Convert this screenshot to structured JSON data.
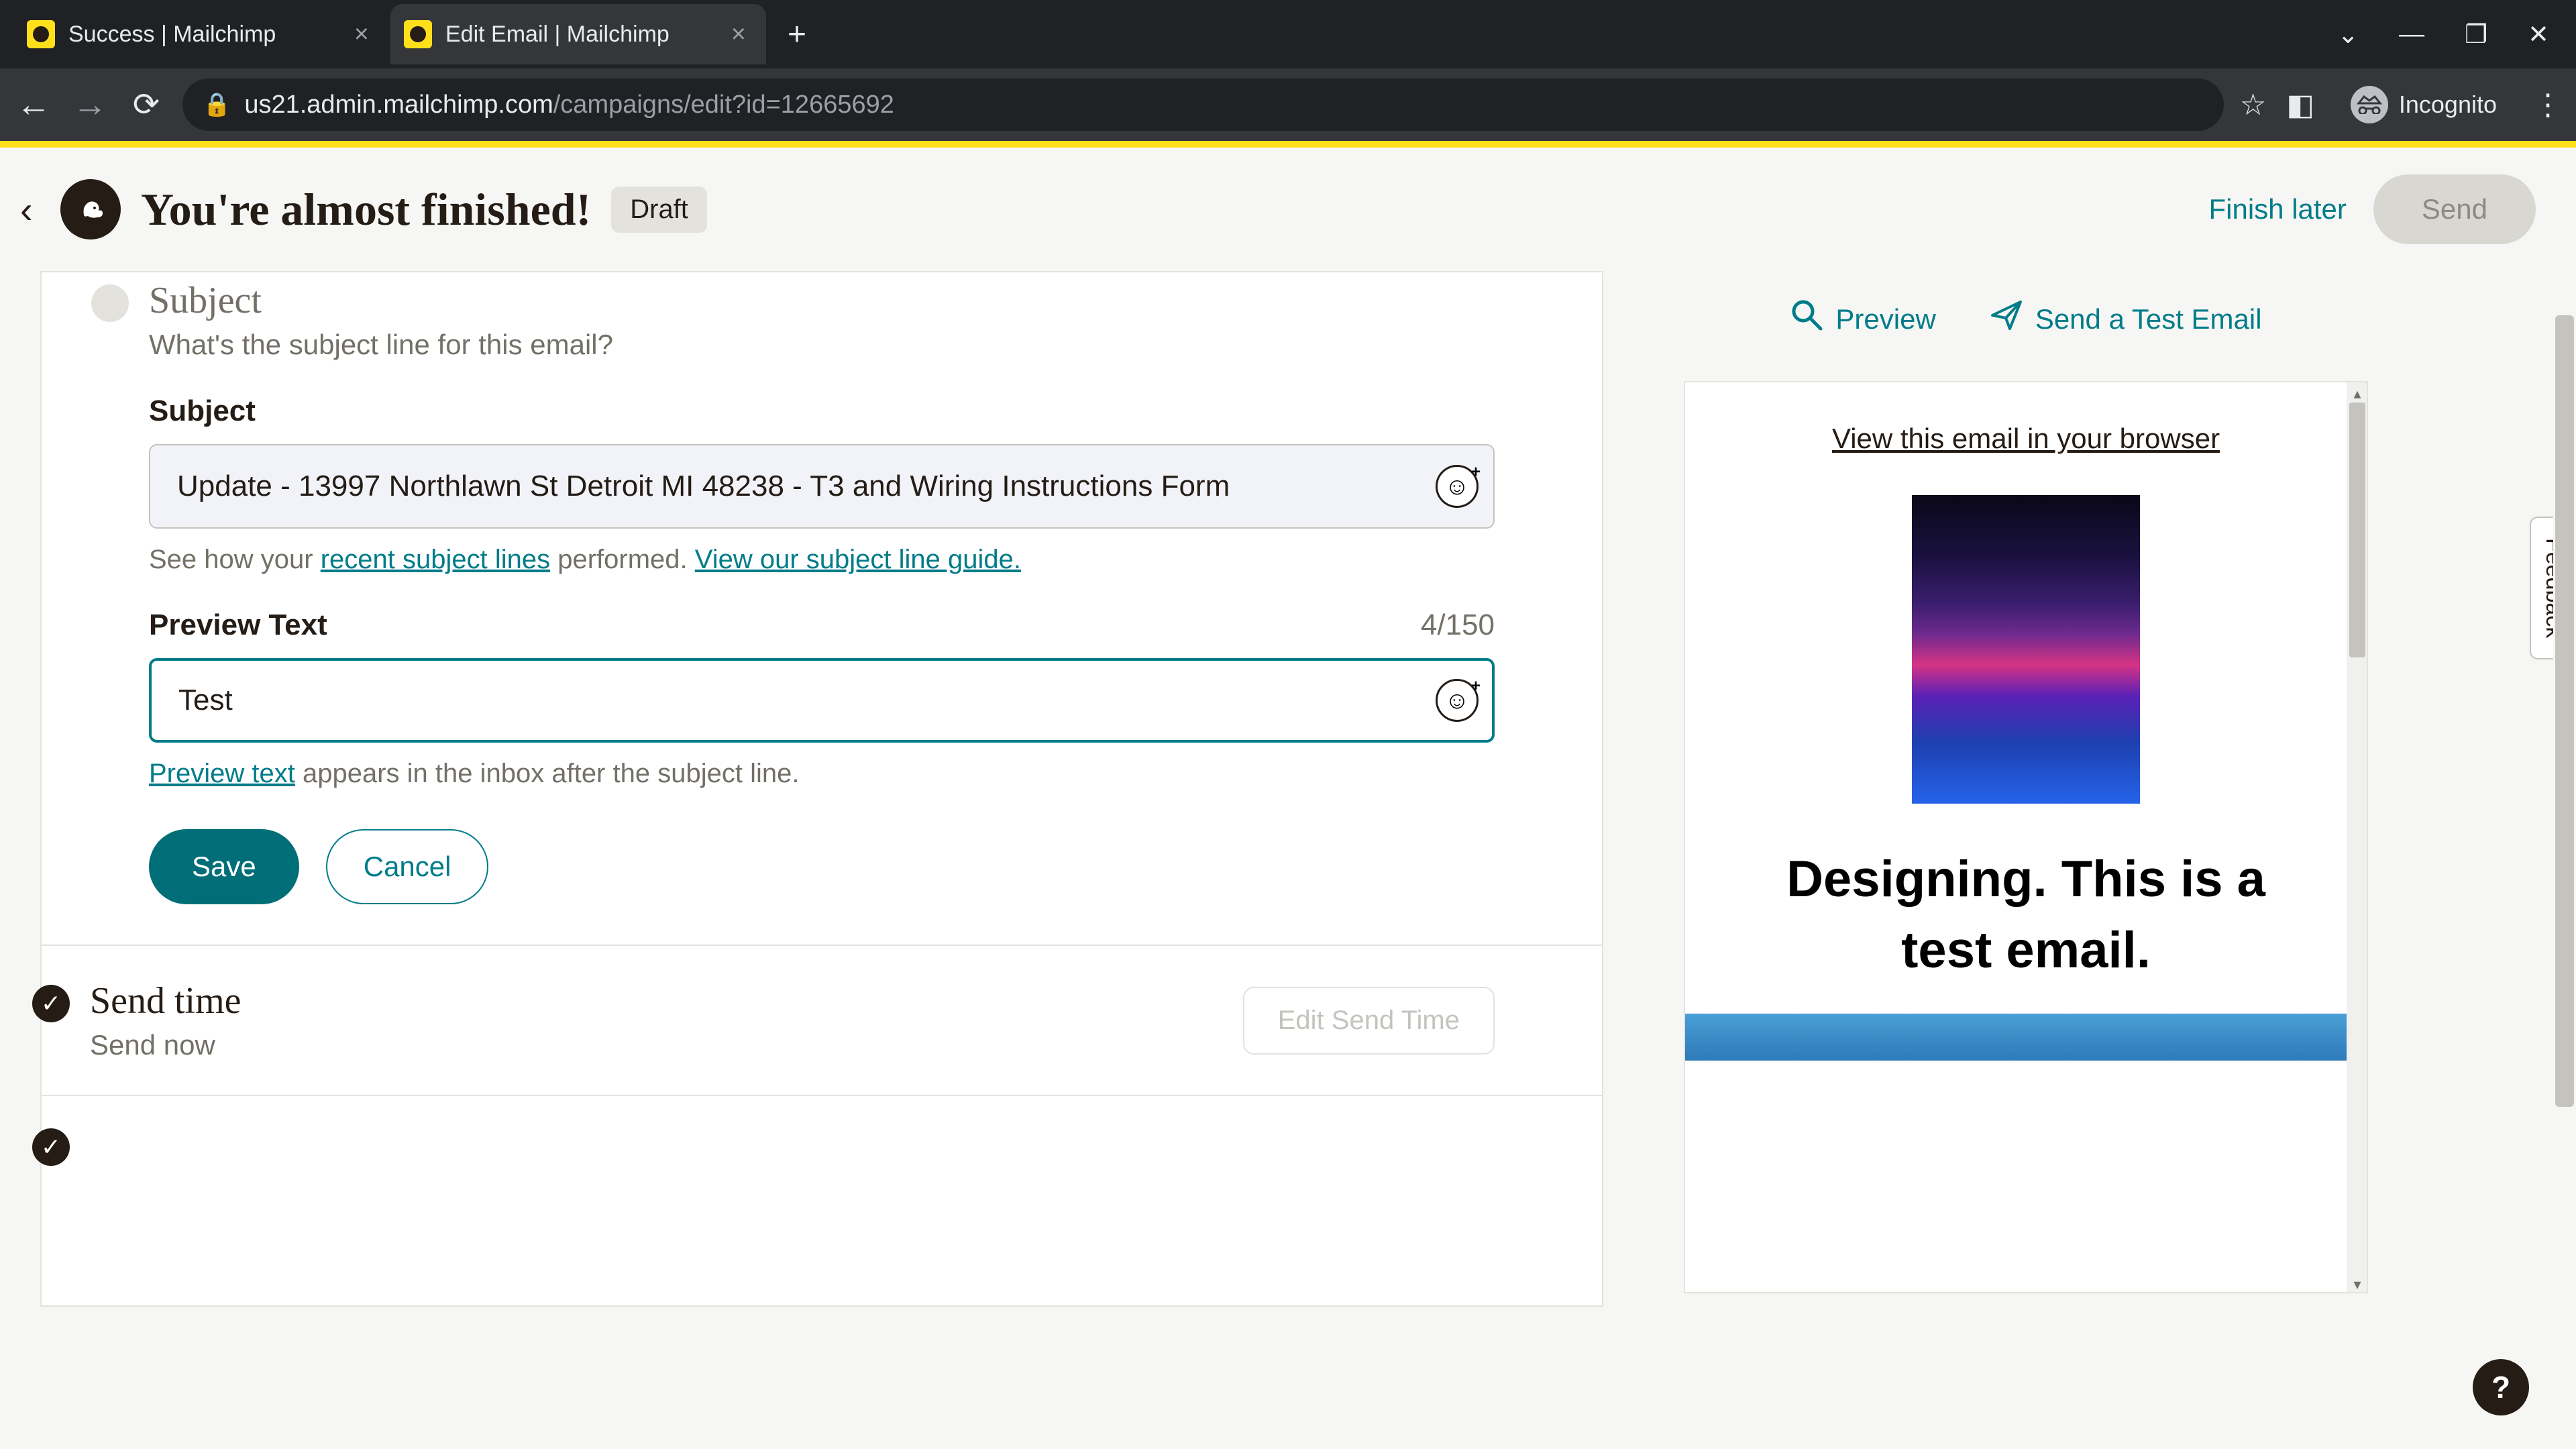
{
  "browser": {
    "tabs": [
      {
        "title": "Success | Mailchimp",
        "active": false
      },
      {
        "title": "Edit Email | Mailchimp",
        "active": true
      }
    ],
    "url_host": "us21.admin.mailchimp.com",
    "url_path": "/campaigns/edit?id=12665692",
    "incognito_label": "Incognito"
  },
  "header": {
    "title": "You're almost finished!",
    "status_badge": "Draft",
    "finish_later": "Finish later",
    "send": "Send"
  },
  "subject_section": {
    "title": "Subject",
    "subtitle": "What's the subject line for this email?",
    "subject_label": "Subject",
    "subject_value": "Update - 13997 Northlawn St Detroit MI 48238 - T3 and Wiring Instructions Form",
    "helper_prefix": "See how your ",
    "helper_link1": "recent subject lines",
    "helper_mid": " performed. ",
    "helper_link2": "View our subject line guide.",
    "preview_label": "Preview Text",
    "preview_count": "4/150",
    "preview_value": "Test",
    "preview_helper_link": "Preview text",
    "preview_helper_rest": " appears in the inbox after the subject line.",
    "save": "Save",
    "cancel": "Cancel"
  },
  "send_time": {
    "title": "Send time",
    "value": "Send now",
    "edit_button": "Edit Send Time"
  },
  "sidebar": {
    "preview": "Preview",
    "send_test": "Send a Test Email",
    "view_in_browser": "View this email in your browser",
    "preview_heading": "Designing. This is a test email."
  },
  "feedback_label": "Feedback",
  "help_label": "?"
}
